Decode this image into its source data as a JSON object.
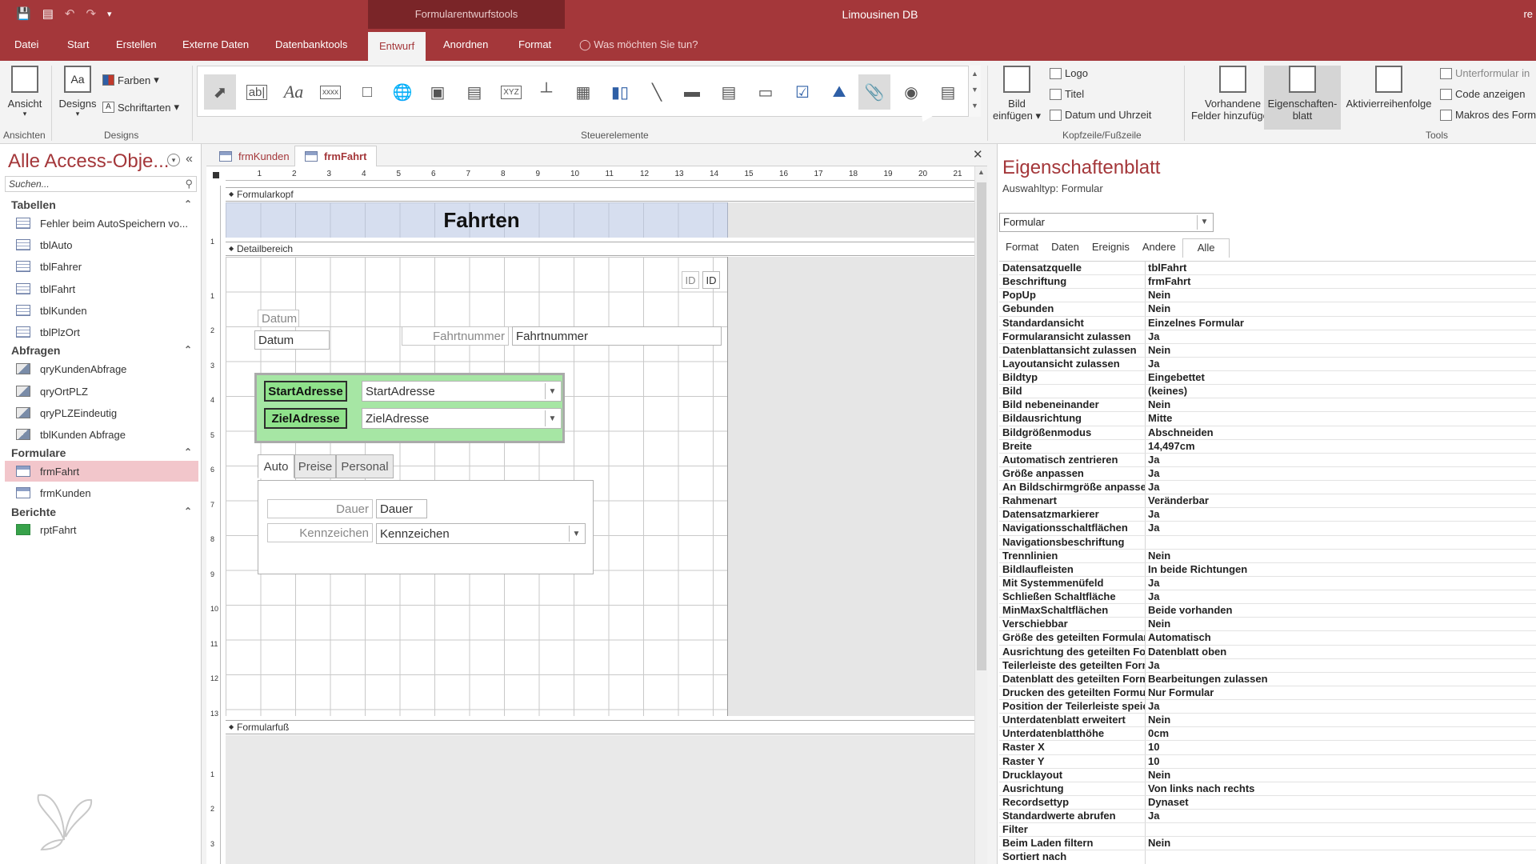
{
  "titlebar": {
    "context_tab": "Formularentwurfstools",
    "app_title": "Limousinen DB",
    "edge_text": "re",
    "qat_icons": [
      "save-icon",
      "view-icon",
      "undo-icon",
      "redo-icon",
      "customize-icon"
    ]
  },
  "menu": {
    "tabs": [
      "Datei",
      "Start",
      "Erstellen",
      "Externe Daten",
      "Datenbanktools",
      "Entwurf",
      "Anordnen",
      "Format"
    ],
    "active": "Entwurf",
    "tell_me": "Was möchten Sie tun?"
  },
  "ribbon": {
    "ansicht": "Ansicht",
    "ansichten_group": "Ansichten",
    "designs": "Designs",
    "farben": "Farben",
    "schriftarten": "Schriftarten",
    "designs_group": "Designs",
    "steuerelemente_group": "Steuerelemente",
    "bild_einfuegen_1": "Bild",
    "bild_einfuegen_2": "einfügen",
    "logo": "Logo",
    "titel": "Titel",
    "datum_uhrzeit": "Datum und Uhrzeit",
    "kopfzeile_group": "Kopfzeile/Fußzeile",
    "vorhandene_1": "Vorhandene",
    "vorhandene_2": "Felder hinzufügen",
    "eigenschaften_1": "Eigenschaften-",
    "eigenschaften_2": "blatt",
    "aktivierreihenfolge": "Aktivierreihenfolge",
    "unterformular": "Unterformular in",
    "code_anzeigen": "Code anzeigen",
    "makros": "Makros des Form",
    "tools_group": "Tools",
    "controls": [
      "select-icon",
      "textbox-icon",
      "label-icon",
      "button-icon",
      "tab-control-icon",
      "hyperlink-icon",
      "web-browser-icon",
      "navigation-icon",
      "option-group-icon",
      "page-break-icon",
      "combobox-icon",
      "chart-icon",
      "line-icon",
      "toggle-icon",
      "listbox-icon",
      "rectangle-icon",
      "checkbox-icon",
      "image-icon",
      "attachment-icon",
      "radio-icon",
      "subform-icon"
    ],
    "textbox_glyph": "ab|",
    "label_glyph": "Aa",
    "button_glyph": "xxxx",
    "option_group_glyph": "XYZ"
  },
  "nav": {
    "title": "Alle Access-Obje...",
    "search_placeholder": "Suchen...",
    "groups": [
      {
        "label": "Tabellen",
        "items": [
          "Fehler beim AutoSpeichern vo...",
          "tblAuto",
          "tblFahrer",
          "tblFahrt",
          "tblKunden",
          "tblPlzOrt"
        ]
      },
      {
        "label": "Abfragen",
        "items": [
          "qryKundenAbfrage",
          "qryOrtPLZ",
          "qryPLZEindeutig",
          "tblKunden Abfrage"
        ]
      },
      {
        "label": "Formulare",
        "items": [
          "frmFahrt",
          "frmKunden"
        ]
      },
      {
        "label": "Berichte",
        "items": [
          "rptFahrt"
        ]
      }
    ],
    "selected": "frmFahrt"
  },
  "document": {
    "tabs": [
      "frmKunden",
      "frmFahrt"
    ],
    "active_tab": "frmFahrt",
    "ruler_h": [
      "1",
      "2",
      "3",
      "4",
      "5",
      "6",
      "7",
      "8",
      "9",
      "10",
      "11",
      "12",
      "13",
      "14",
      "15",
      "16",
      "17",
      "18",
      "19",
      "20",
      "21"
    ],
    "ruler_v_head": [
      "1"
    ],
    "ruler_v_detail": [
      "1",
      "2",
      "3",
      "4",
      "5",
      "6",
      "7",
      "8",
      "9",
      "10",
      "11",
      "12",
      "13"
    ],
    "ruler_v_foot": [
      "1",
      "2",
      "3"
    ],
    "sections": {
      "header": "Formularkopf",
      "detail": "Detailbereich",
      "footer": "Formularfuß"
    },
    "form_title": "Fahrten",
    "controls": {
      "id_label": "ID",
      "id_field": "ID",
      "datum_label": "Datum",
      "datum_field": "Datum",
      "fahrtnummer_label": "Fahrtnummer",
      "fahrtnummer_field": "Fahrtnummer",
      "start_label": "StartAdresse",
      "start_field": "StartAdresse",
      "ziel_label": "ZielAdresse",
      "ziel_field": "ZielAdresse",
      "tabs": [
        "Auto",
        "Preise",
        "Personal"
      ],
      "active_tab": "Auto",
      "dauer_label": "Dauer",
      "dauer_field": "Dauer",
      "kennzeichen_label": "Kennzeichen",
      "kennzeichen_field": "Kennzeichen"
    }
  },
  "propsheet": {
    "title": "Eigenschaftenblatt",
    "selection_type": "Auswahltyp:  Formular",
    "selected_object": "Formular",
    "tabs": [
      "Format",
      "Daten",
      "Ereignis",
      "Andere",
      "Alle"
    ],
    "active_tab": "Alle",
    "rows": [
      [
        "Datensatzquelle",
        "tblFahrt"
      ],
      [
        "Beschriftung",
        "frmFahrt"
      ],
      [
        "PopUp",
        "Nein"
      ],
      [
        "Gebunden",
        "Nein"
      ],
      [
        "Standardansicht",
        "Einzelnes Formular"
      ],
      [
        "Formularansicht zulassen",
        "Ja"
      ],
      [
        "Datenblattansicht zulassen",
        "Nein"
      ],
      [
        "Layoutansicht zulassen",
        "Ja"
      ],
      [
        "Bildtyp",
        "Eingebettet"
      ],
      [
        "Bild",
        "(keines)"
      ],
      [
        "Bild nebeneinander",
        "Nein"
      ],
      [
        "Bildausrichtung",
        "Mitte"
      ],
      [
        "Bildgrößenmodus",
        "Abschneiden"
      ],
      [
        "Breite",
        "14,497cm"
      ],
      [
        "Automatisch zentrieren",
        "Ja"
      ],
      [
        "Größe anpassen",
        "Ja"
      ],
      [
        "An Bildschirmgröße anpassen",
        "Ja"
      ],
      [
        "Rahmenart",
        "Veränderbar"
      ],
      [
        "Datensatzmarkierer",
        "Ja"
      ],
      [
        "Navigationsschaltflächen",
        "Ja"
      ],
      [
        "Navigationsbeschriftung",
        ""
      ],
      [
        "Trennlinien",
        "Nein"
      ],
      [
        "Bildlaufleisten",
        "In beide Richtungen"
      ],
      [
        "Mit Systemmenüfeld",
        "Ja"
      ],
      [
        "Schließen Schaltfläche",
        "Ja"
      ],
      [
        "MinMaxSchaltflächen",
        "Beide vorhanden"
      ],
      [
        "Verschiebbar",
        "Nein"
      ],
      [
        "Größe des geteilten Formulars",
        "Automatisch"
      ],
      [
        "Ausrichtung des geteilten Formulars",
        "Datenblatt oben"
      ],
      [
        "Teilerleiste des geteilten Formulars",
        "Ja"
      ],
      [
        "Datenblatt des geteilten Formulars",
        "Bearbeitungen zulassen"
      ],
      [
        "Drucken des geteilten Formulars",
        "Nur Formular"
      ],
      [
        "Position der Teilerleiste speichern",
        "Ja"
      ],
      [
        "Unterdatenblatt erweitert",
        "Nein"
      ],
      [
        "Unterdatenblatthöhe",
        "0cm"
      ],
      [
        "Raster X",
        "10"
      ],
      [
        "Raster Y",
        "10"
      ],
      [
        "Drucklayout",
        "Nein"
      ],
      [
        "Ausrichtung",
        "Von links nach rechts"
      ],
      [
        "Recordsettyp",
        "Dynaset"
      ],
      [
        "Standardwerte abrufen",
        "Ja"
      ],
      [
        "Filter",
        ""
      ],
      [
        "Beim Laden filtern",
        "Nein"
      ],
      [
        "Sortiert nach",
        ""
      ]
    ]
  },
  "colors": {
    "accent": "#a4373a",
    "selected_nav": "#f2c6cb",
    "green_box": "#a6e6a4",
    "green_label": "#8fe28b"
  }
}
